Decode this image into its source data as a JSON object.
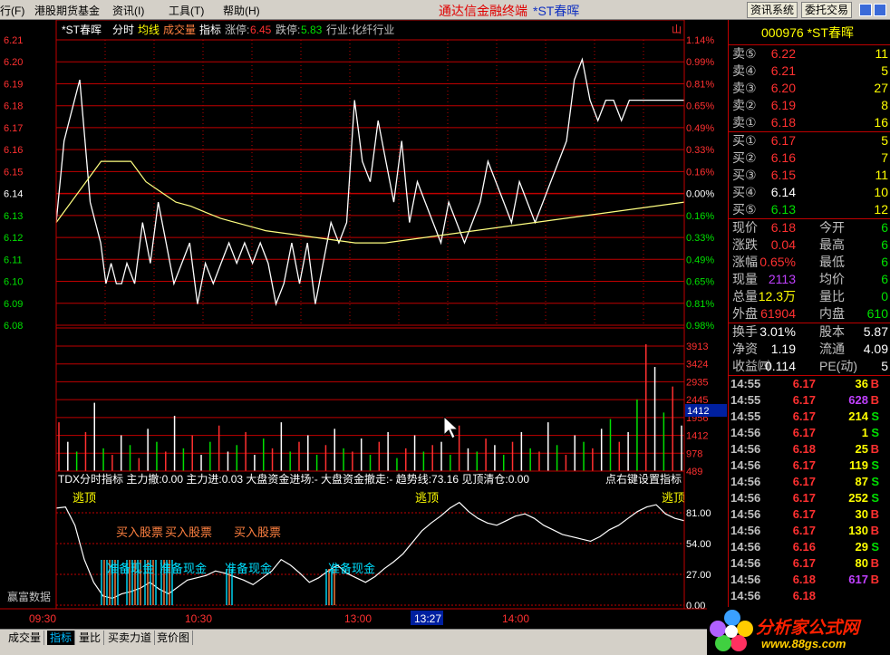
{
  "menu": {
    "items": [
      "行(F)",
      "港股期货基金",
      "资讯(I)",
      "工具(T)",
      "帮助(H)"
    ]
  },
  "title": {
    "main": "通达信金融终端",
    "sub": "*ST春晖"
  },
  "sys_buttons": [
    "资讯系统",
    "委托交易"
  ],
  "chart_header": {
    "name": "*ST春晖",
    "mode": "分时",
    "avg_label": "均线",
    "vol_label": "成交量",
    "ind_label": "指标",
    "limit_up_label": "涨停:",
    "limit_up": "6.45",
    "limit_down_label": "跌停:",
    "limit_down": "5.83",
    "industry": "行业:化纤行业",
    "corner": "山"
  },
  "price_axis": {
    "left": [
      "6.21",
      "6.20",
      "6.19",
      "6.18",
      "6.17",
      "6.16",
      "6.15",
      "6.14",
      "6.13",
      "6.12",
      "6.11",
      "6.10",
      "6.09",
      "6.08"
    ],
    "right": [
      "1.14%",
      "0.99%",
      "0.81%",
      "0.65%",
      "0.49%",
      "0.33%",
      "0.16%",
      "0.00%",
      "0.16%",
      "0.33%",
      "0.49%",
      "0.65%",
      "0.81%",
      "0.98%"
    ]
  },
  "volume_axis": [
    "3913",
    "3424",
    "2935",
    "2445",
    "1956",
    "1412",
    "978",
    "489"
  ],
  "volume_cursor": "1412",
  "indicator_header": {
    "text": "TDX分时指标 主力撤:0.00 主力进:0.03 大盘资金进场:- 大盘资金撤走:- 趋势线:73.16 见顶清仓:0.00",
    "hint": "点右键设置指标"
  },
  "indicator_axis": [
    "81.00",
    "54.00",
    "27.00",
    "0.00"
  ],
  "indicator_annotations": {
    "top": "逃顶",
    "buy": "买入股票",
    "cash": "准备现金"
  },
  "source_label": "赢富数据",
  "time_axis": [
    "09:30",
    "10:30",
    "13:00",
    "13:27",
    "14:00"
  ],
  "chart_data": {
    "type": "line",
    "price": {
      "prev_close": 6.14,
      "ylim": [
        6.075,
        6.215
      ],
      "x": [
        0,
        3,
        5,
        7,
        9,
        11,
        13,
        15,
        17,
        19,
        21,
        23,
        25,
        27,
        30,
        33,
        36,
        39,
        42,
        45,
        48,
        51,
        54,
        57,
        60,
        63,
        66,
        69,
        72,
        75,
        78,
        81,
        84,
        87,
        90,
        93,
        96,
        99,
        102,
        105,
        108,
        111,
        114,
        117,
        120,
        123,
        126,
        129,
        132,
        135,
        138,
        141,
        144,
        147,
        150,
        153,
        156,
        159,
        162,
        165,
        168,
        171,
        174,
        177,
        180,
        183,
        186,
        189,
        192,
        195,
        198,
        201,
        204,
        207,
        210,
        213,
        216,
        219,
        222,
        225,
        228,
        231,
        234,
        237,
        240
      ],
      "y": [
        6.12,
        6.16,
        6.17,
        6.18,
        6.19,
        6.16,
        6.13,
        6.12,
        6.11,
        6.09,
        6.1,
        6.09,
        6.09,
        6.1,
        6.09,
        6.12,
        6.1,
        6.13,
        6.11,
        6.09,
        6.1,
        6.11,
        6.08,
        6.1,
        6.09,
        6.1,
        6.11,
        6.1,
        6.11,
        6.1,
        6.11,
        6.1,
        6.08,
        6.09,
        6.11,
        6.09,
        6.11,
        6.08,
        6.1,
        6.12,
        6.11,
        6.12,
        6.18,
        6.15,
        6.14,
        6.17,
        6.15,
        6.13,
        6.16,
        6.12,
        6.14,
        6.13,
        6.12,
        6.11,
        6.13,
        6.12,
        6.11,
        6.12,
        6.13,
        6.15,
        6.14,
        6.13,
        6.12,
        6.14,
        6.13,
        6.12,
        6.13,
        6.14,
        6.15,
        6.16,
        6.19,
        6.2,
        6.18,
        6.17,
        6.18,
        6.18,
        6.17,
        6.18,
        6.18,
        6.18,
        6.18,
        6.18,
        6.18,
        6.18,
        6.18
      ],
      "avg": [
        6.12,
        6.13,
        6.14,
        6.15,
        6.15,
        6.15,
        6.14,
        6.135,
        6.13,
        6.128,
        6.125,
        6.122,
        6.12,
        6.118,
        6.116,
        6.115,
        6.114,
        6.113,
        6.112,
        6.111,
        6.11,
        6.11,
        6.11,
        6.111,
        6.112,
        6.113,
        6.114,
        6.115,
        6.116,
        6.117,
        6.118,
        6.119,
        6.12,
        6.121,
        6.122,
        6.123,
        6.124,
        6.125,
        6.126,
        6.127,
        6.128,
        6.129,
        6.13
      ]
    },
    "volume": {
      "ylim": [
        0,
        4400
      ],
      "values": [
        1500,
        900,
        600,
        1200,
        2100,
        700,
        500,
        1100,
        800,
        400,
        1300,
        900,
        600,
        1700,
        700,
        1100,
        500,
        900,
        1400,
        600,
        800,
        1200,
        500,
        1000,
        700,
        1500,
        600,
        900,
        1100,
        500,
        800,
        1300,
        700,
        600,
        1000,
        500,
        900,
        1200,
        400,
        700,
        1100,
        600,
        800,
        900,
        500,
        1400,
        700,
        600,
        1000,
        800,
        500,
        900,
        1200,
        700,
        600,
        1500,
        800,
        500,
        1100,
        900,
        700,
        1300,
        1600,
        900,
        1200,
        2200,
        3900,
        3200,
        1800,
        2600,
        1400
      ]
    },
    "indicator": {
      "ylim": [
        0,
        100
      ],
      "values": [
        85,
        86,
        70,
        40,
        20,
        8,
        6,
        10,
        12,
        15,
        20,
        14,
        10,
        16,
        22,
        24,
        26,
        30,
        28,
        25,
        22,
        18,
        24,
        30,
        40,
        35,
        28,
        20,
        24,
        30,
        35,
        28,
        24,
        20,
        25,
        32,
        38,
        45,
        55,
        65,
        72,
        78,
        85,
        90,
        82,
        76,
        72,
        70,
        74,
        78,
        80,
        76,
        70,
        66,
        62,
        60,
        58,
        56,
        60,
        66,
        70,
        76,
        82,
        86,
        88,
        80,
        76,
        74
      ]
    }
  },
  "quote_panel": {
    "code": "000976",
    "name": "*ST春晖",
    "asks": [
      {
        "label": "卖⑤",
        "price": "6.22",
        "vol": "11"
      },
      {
        "label": "卖④",
        "price": "6.21",
        "vol": "5"
      },
      {
        "label": "卖③",
        "price": "6.20",
        "vol": "27"
      },
      {
        "label": "卖②",
        "price": "6.19",
        "vol": "8"
      },
      {
        "label": "卖①",
        "price": "6.18",
        "vol": "16"
      }
    ],
    "bids": [
      {
        "label": "买①",
        "price": "6.17",
        "vol": "5"
      },
      {
        "label": "买②",
        "price": "6.16",
        "vol": "7"
      },
      {
        "label": "买③",
        "price": "6.15",
        "vol": "11"
      },
      {
        "label": "买④",
        "price": "6.14",
        "vol": "10"
      },
      {
        "label": "买⑤",
        "price": "6.13",
        "vol": "12"
      }
    ],
    "stats": [
      {
        "l1": "现价",
        "v1": "6.18",
        "l2": "今开",
        "v2": "6"
      },
      {
        "l1": "涨跌",
        "v1": "0.04",
        "l2": "最高",
        "v2": "6"
      },
      {
        "l1": "涨幅",
        "v1": "0.65%",
        "l2": "最低",
        "v2": "6"
      },
      {
        "l1": "现量",
        "v1": "2113",
        "l2": "均价",
        "v2": "6"
      },
      {
        "l1": "总量",
        "v1": "12.3万",
        "l2": "量比",
        "v2": "0"
      },
      {
        "l1": "外盘",
        "v1": "61904",
        "l2": "内盘",
        "v2": "610"
      }
    ],
    "fin": [
      {
        "l1": "换手",
        "v1": "3.01%",
        "l2": "股本",
        "v2": "5.87"
      },
      {
        "l1": "净资",
        "v1": "1.19",
        "l2": "流通",
        "v2": "4.09"
      },
      {
        "l1": "收益㈣",
        "v1": "0.114",
        "l2": "PE(动)",
        "v2": "5"
      }
    ],
    "ticks": [
      {
        "t": "14:55",
        "p": "6.17",
        "q": "36",
        "s": "B"
      },
      {
        "t": "14:55",
        "p": "6.17",
        "q": "628",
        "s": "B"
      },
      {
        "t": "14:55",
        "p": "6.17",
        "q": "214",
        "s": "S"
      },
      {
        "t": "14:56",
        "p": "6.17",
        "q": "1",
        "s": "S"
      },
      {
        "t": "14:56",
        "p": "6.18",
        "q": "25",
        "s": "B"
      },
      {
        "t": "14:56",
        "p": "6.17",
        "q": "119",
        "s": "S"
      },
      {
        "t": "14:56",
        "p": "6.17",
        "q": "87",
        "s": "S"
      },
      {
        "t": "14:56",
        "p": "6.17",
        "q": "252",
        "s": "S"
      },
      {
        "t": "14:56",
        "p": "6.17",
        "q": "30",
        "s": "B"
      },
      {
        "t": "14:56",
        "p": "6.17",
        "q": "130",
        "s": "B"
      },
      {
        "t": "14:56",
        "p": "6.16",
        "q": "29",
        "s": "S"
      },
      {
        "t": "14:56",
        "p": "6.17",
        "q": "80",
        "s": "B"
      },
      {
        "t": "14:56",
        "p": "6.18",
        "q": "617",
        "s": "B"
      },
      {
        "t": "14:56",
        "p": "6.18",
        "q": "",
        "s": ""
      }
    ]
  },
  "bottom_tabs": [
    "成交量",
    "指标",
    "量比",
    "买卖力道",
    "竞价图"
  ],
  "logo": {
    "brand": "分析家公式网",
    "url": "www.88gs.com"
  },
  "colors": {
    "up": "#ff3030",
    "down": "#00e000",
    "grid": "#c00000",
    "price_line": "#ffffff",
    "avg_line": "#ffff80",
    "label": "#c0c0c0",
    "yellow": "#ffff00",
    "cyan": "#00e0ff"
  }
}
